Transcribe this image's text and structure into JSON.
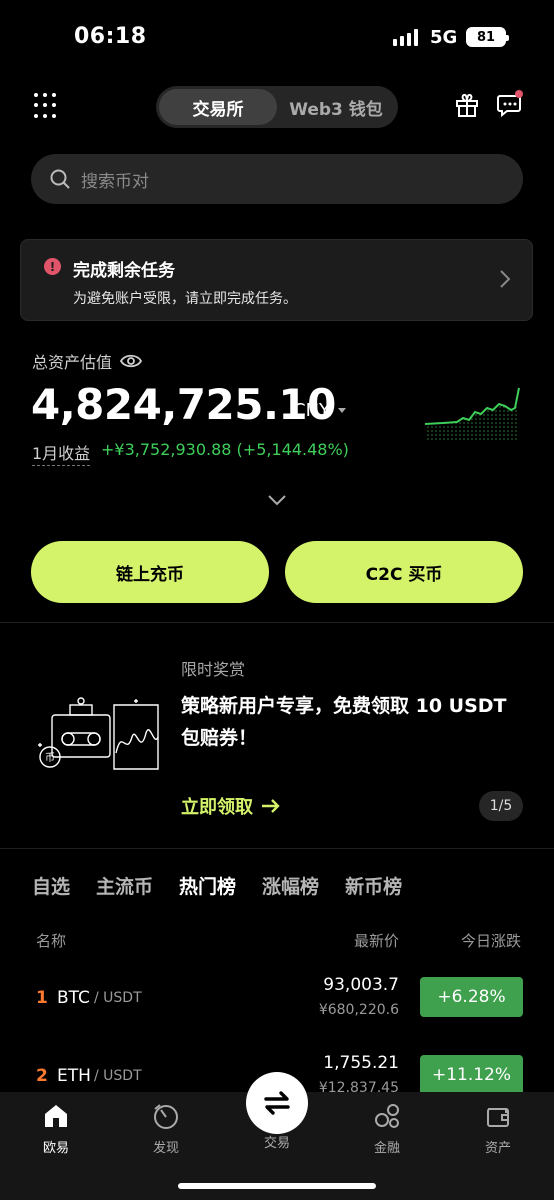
{
  "status_bar": {
    "time": "06:18",
    "network": "5G",
    "battery": "81"
  },
  "header": {
    "segments": [
      "交易所",
      "Web3 钱包"
    ],
    "active_segment": "交易所"
  },
  "search": {
    "placeholder": "搜索币对"
  },
  "task_banner": {
    "title": "完成剩余任务",
    "subtitle": "为避免账户受限，请立即完成任务。"
  },
  "assets": {
    "label": "总资产估值",
    "value": "4,824,725.10",
    "currency": "CNY",
    "pnl_label": "1月收益",
    "pnl_value": "+¥3,752,930.88 (+5,144.48%)"
  },
  "actions": {
    "deposit_label": "链上充币",
    "c2c_label": "C2C 买币"
  },
  "promo": {
    "tag": "限时奖赏",
    "title": "策略新用户专享，免费领取 10 USDT 包赔券！",
    "cta": "立即领取",
    "page": "1/5"
  },
  "market_tabs": [
    "自选",
    "主流币",
    "热门榜",
    "涨幅榜",
    "新币榜"
  ],
  "active_market_tab": "热门榜",
  "table": {
    "headers": {
      "name": "名称",
      "price": "最新价",
      "change": "今日涨跌"
    },
    "rows": [
      {
        "rank": "1",
        "symbol": "BTC",
        "quote": "/ USDT",
        "price": "93,003.7",
        "fiat": "¥680,220.6",
        "change": "+6.28%"
      },
      {
        "rank": "2",
        "symbol": "ETH",
        "quote": "/ USDT",
        "price": "1,755.21",
        "fiat": "¥12,837.45",
        "change": "+11.12%"
      }
    ]
  },
  "bottom_nav": [
    "欧易",
    "发现",
    "交易",
    "金融",
    "资产"
  ],
  "colors": {
    "accent": "#d4f36a",
    "positive": "#3ecf5a",
    "badge": "#3fa04e",
    "rank": "#ff7a2f"
  }
}
